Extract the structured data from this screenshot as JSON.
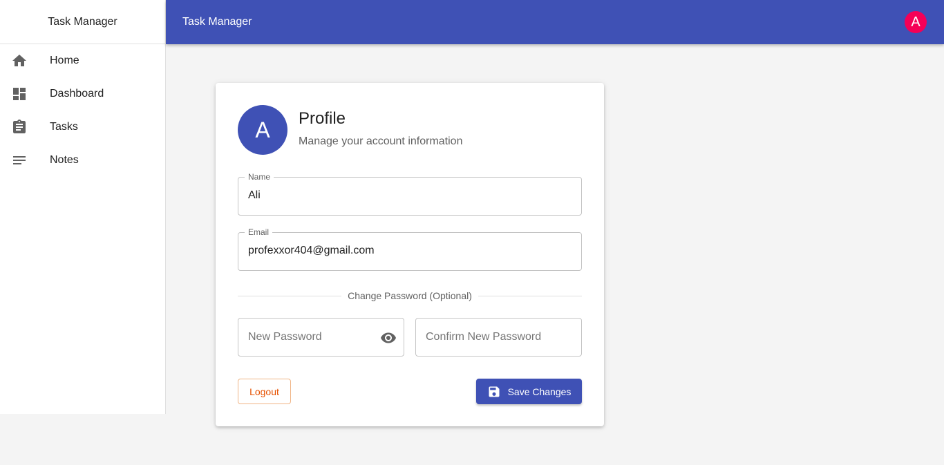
{
  "sidebar": {
    "title": "Task Manager",
    "items": [
      {
        "label": "Home",
        "icon": "home-icon"
      },
      {
        "label": "Dashboard",
        "icon": "dashboard-icon"
      },
      {
        "label": "Tasks",
        "icon": "assignment-icon"
      },
      {
        "label": "Notes",
        "icon": "notes-icon"
      }
    ]
  },
  "topbar": {
    "title": "Task Manager",
    "avatar_letter": "A"
  },
  "profile": {
    "avatar_letter": "A",
    "title": "Profile",
    "subtitle": "Manage your account information",
    "name_label": "Name",
    "name_value": "Ali",
    "email_label": "Email",
    "email_value": "profexxor404@gmail.com",
    "divider_text": "Change Password (Optional)",
    "new_password_placeholder": "New Password",
    "confirm_password_placeholder": "Confirm New Password",
    "logout_label": "Logout",
    "save_label": "Save Changes"
  },
  "colors": {
    "primary": "#3f51b5",
    "accent": "#f50057",
    "logout": "#e65100"
  }
}
